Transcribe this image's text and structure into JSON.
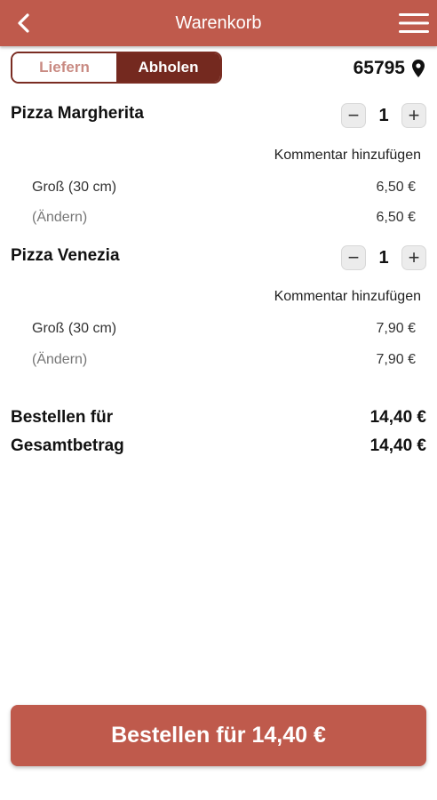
{
  "header": {
    "title": "Warenkorb",
    "back_icon": "chevron-left-icon",
    "menu_icon": "hamburger-menu-icon",
    "color": "#bf5a4c"
  },
  "mode_toggle": {
    "options": [
      "Liefern",
      "Abholen"
    ],
    "selected": "Abholen",
    "active_color": "#74291f"
  },
  "location": {
    "zip": "65795",
    "icon": "map-pin-icon"
  },
  "items": [
    {
      "name": "Pizza Margherita",
      "quantity": "1",
      "decrement": "−",
      "increment": "+",
      "comment_link": "Kommentar hinzufügen",
      "size_label": "Groß (30 cm)",
      "size_price": "6,50 €",
      "change_label": "(Ändern)",
      "line_price": "6,50 €"
    },
    {
      "name": "Pizza Venezia",
      "quantity": "1",
      "decrement": "−",
      "increment": "+",
      "comment_link": "Kommentar hinzufügen",
      "size_label": "Groß (30 cm)",
      "size_price": "7,90 €",
      "change_label": "(Ändern)",
      "line_price": "7,90 €"
    }
  ],
  "totals": {
    "order_for_label": "Bestellen für",
    "order_for_value": "14,40 €",
    "grand_total_label": "Gesamtbetrag",
    "grand_total_value": "14,40 €"
  },
  "order_button": {
    "label": "Bestellen für 14,40 €",
    "color": "#bf5a4c"
  }
}
